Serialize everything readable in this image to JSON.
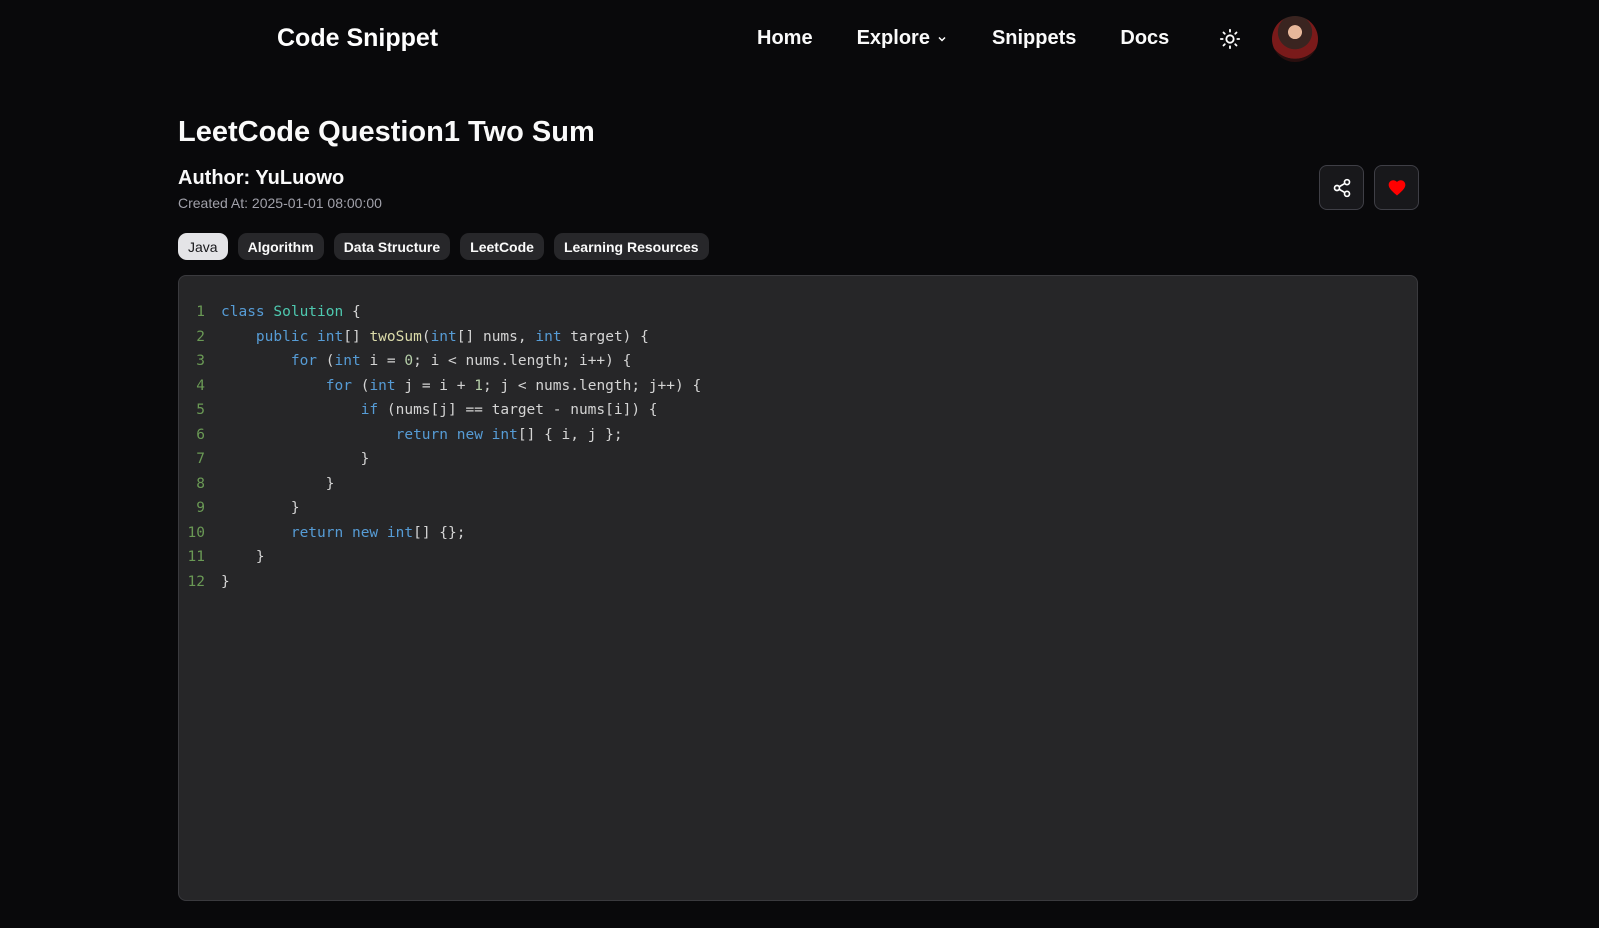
{
  "nav": {
    "brand": "Code Snippet",
    "links": [
      "Home",
      "Explore",
      "Snippets",
      "Docs"
    ]
  },
  "snippet": {
    "title": "LeetCode Question1 Two Sum",
    "author": "Author: YuLuowo",
    "created": "Created At: 2025-01-01 08:00:00",
    "tags": [
      "Java",
      "Algorithm",
      "Data Structure",
      "LeetCode",
      "Learning Resources"
    ],
    "active_tag": "Java"
  },
  "colors": {
    "heart": "#ff0000",
    "keyword": "#569cd6",
    "class": "#4ec9b0",
    "function": "#dcdcaa",
    "number": "#b5cea8"
  },
  "code_lines": [
    [
      [
        "kw",
        "class"
      ],
      [
        "tx",
        " "
      ],
      [
        "cls",
        "Solution"
      ],
      [
        "tx",
        " {"
      ]
    ],
    [
      [
        "tx",
        "    "
      ],
      [
        "kw",
        "public"
      ],
      [
        "tx",
        " "
      ],
      [
        "kw",
        "int"
      ],
      [
        "tx",
        "[] "
      ],
      [
        "fn",
        "twoSum"
      ],
      [
        "tx",
        "("
      ],
      [
        "kw",
        "int"
      ],
      [
        "tx",
        "[] nums, "
      ],
      [
        "kw",
        "int"
      ],
      [
        "tx",
        " target) {"
      ]
    ],
    [
      [
        "tx",
        "        "
      ],
      [
        "kw",
        "for"
      ],
      [
        "tx",
        " ("
      ],
      [
        "kw",
        "int"
      ],
      [
        "tx",
        " i = "
      ],
      [
        "num",
        "0"
      ],
      [
        "tx",
        "; i < nums.length; i++) {"
      ]
    ],
    [
      [
        "tx",
        "            "
      ],
      [
        "kw",
        "for"
      ],
      [
        "tx",
        " ("
      ],
      [
        "kw",
        "int"
      ],
      [
        "tx",
        " j = i + "
      ],
      [
        "num",
        "1"
      ],
      [
        "tx",
        "; j < nums.length; j++) {"
      ]
    ],
    [
      [
        "tx",
        "                "
      ],
      [
        "kw",
        "if"
      ],
      [
        "tx",
        " (nums[j] == target - nums[i]) {"
      ]
    ],
    [
      [
        "tx",
        "                    "
      ],
      [
        "kw",
        "return"
      ],
      [
        "tx",
        " "
      ],
      [
        "kw",
        "new"
      ],
      [
        "tx",
        " "
      ],
      [
        "kw",
        "int"
      ],
      [
        "tx",
        "[] { i, j };"
      ]
    ],
    [
      [
        "tx",
        "                }"
      ]
    ],
    [
      [
        "tx",
        "            }"
      ]
    ],
    [
      [
        "tx",
        "        }"
      ]
    ],
    [
      [
        "tx",
        "        "
      ],
      [
        "kw",
        "return"
      ],
      [
        "tx",
        " "
      ],
      [
        "kw",
        "new"
      ],
      [
        "tx",
        " "
      ],
      [
        "kw",
        "int"
      ],
      [
        "tx",
        "[] {};"
      ]
    ],
    [
      [
        "tx",
        "    }"
      ]
    ],
    [
      [
        "tx",
        "}"
      ]
    ]
  ]
}
